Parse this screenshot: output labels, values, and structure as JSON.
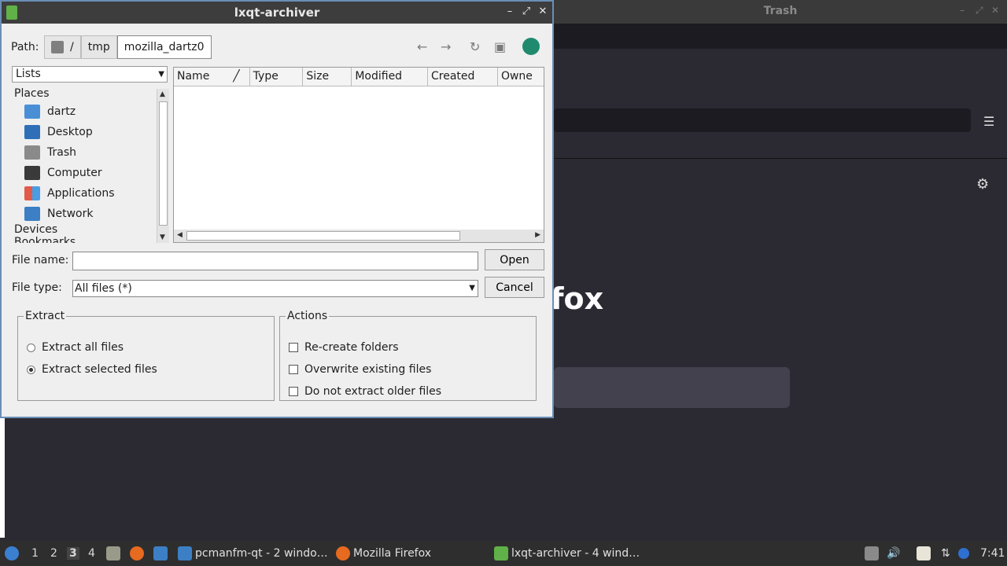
{
  "background_window": {
    "title": "Trash",
    "brand_text": "fox"
  },
  "dialog": {
    "title": "lxqt-archiver",
    "path": {
      "label": "Path:",
      "crumbs": [
        "/",
        "tmp",
        "mozilla_dartz0"
      ]
    },
    "lists_combo": "Lists",
    "places": {
      "header": "Places",
      "items": [
        "dartz",
        "Desktop",
        "Trash",
        "Computer",
        "Applications",
        "Network"
      ],
      "devices_header": "Devices",
      "bookmarks_header": "Bookmarks"
    },
    "file_columns": [
      "Name",
      "Type",
      "Size",
      "Modified",
      "Created",
      "Owne"
    ],
    "file_name": {
      "label": "File name:",
      "value": ""
    },
    "file_type": {
      "label": "File type:",
      "value": "All files (*)"
    },
    "open_label": "Open",
    "cancel_label": "Cancel",
    "extract": {
      "legend": "Extract",
      "all_files": "Extract all files",
      "selected_files": "Extract selected files",
      "selected": "selected_files"
    },
    "actions": {
      "legend": "Actions",
      "recreate_folders": "Re-create folders",
      "overwrite_existing": "Overwrite existing files",
      "no_older": "Do not extract older files"
    }
  },
  "taskbar": {
    "workspaces": [
      "1",
      "2",
      "3",
      "4"
    ],
    "current_workspace": "3",
    "tasks": [
      "pcmanfm-qt - 2 windo…",
      "Mozilla Firefox",
      "lxqt-archiver - 4 wind…"
    ],
    "clock": "7:41"
  }
}
